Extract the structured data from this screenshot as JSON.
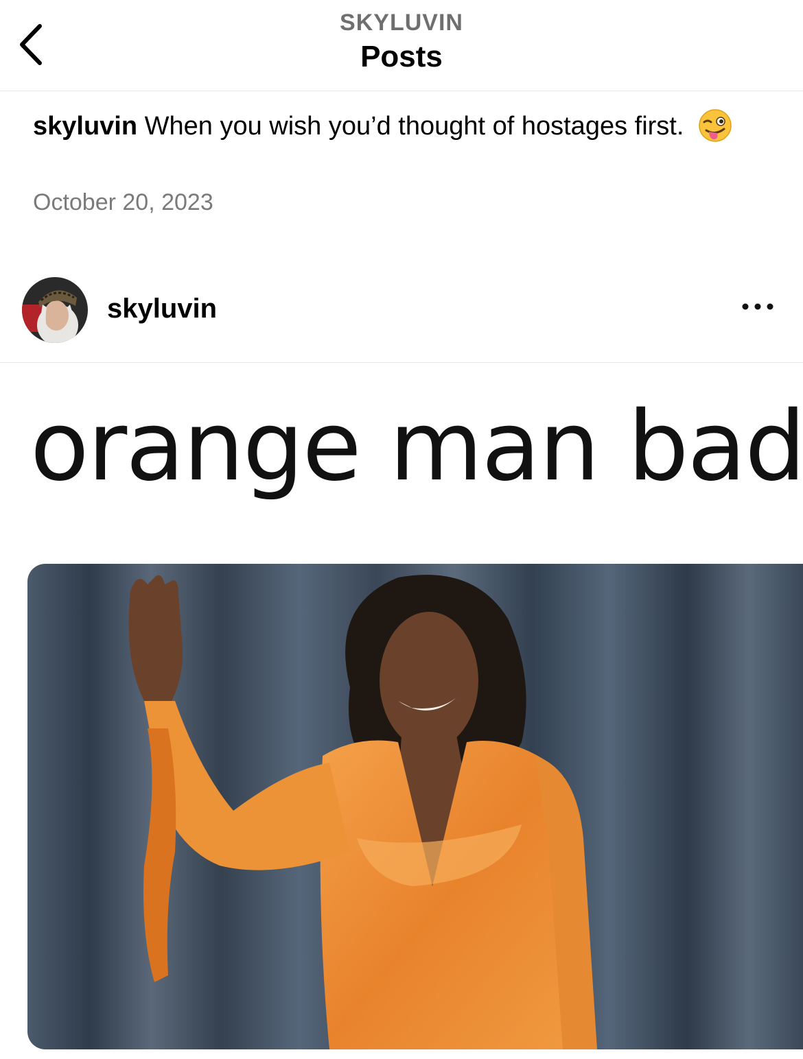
{
  "header": {
    "back_icon": "chevron-left-icon",
    "account": "SKYLUVIN",
    "title": "Posts"
  },
  "caption": {
    "username": "skyluvin",
    "text": " When you wish you’d thought of hostages first.",
    "emoji": "winking-face-with-tongue-icon",
    "date": "October 20, 2023"
  },
  "post": {
    "username": "skyluvin",
    "more_icon": "more-horizontal-icon",
    "meme_text": "orange man bad"
  },
  "colors": {
    "secondary_text": "#7a7a7a",
    "dress_orange": "#e9882f",
    "curtain": "#3f4f62"
  }
}
